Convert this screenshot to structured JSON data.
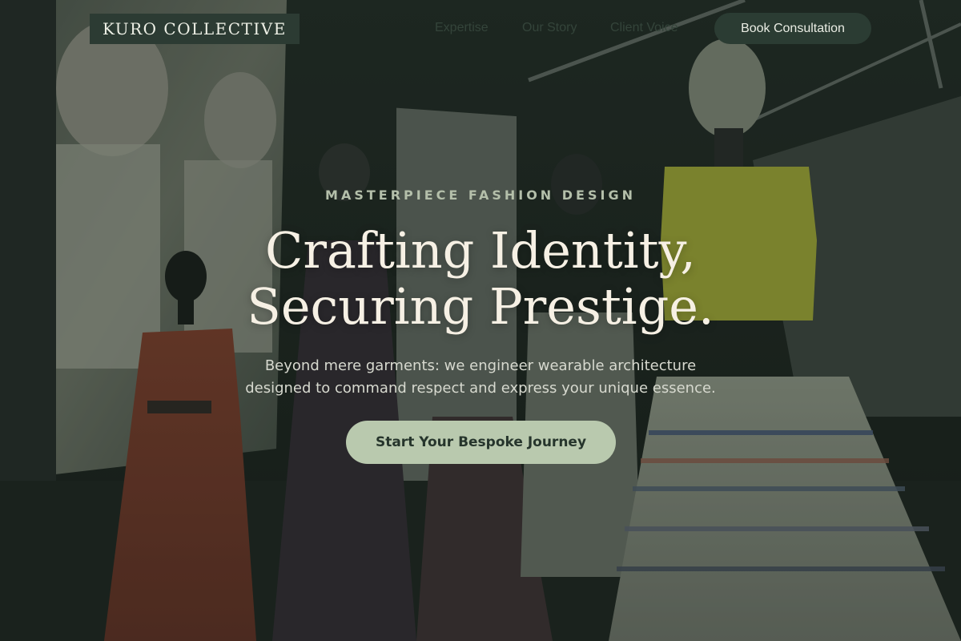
{
  "brand": {
    "name": "KURO COLLECTIVE"
  },
  "nav": {
    "links": [
      "Expertise",
      "Our Story",
      "Client Voice"
    ],
    "cta_label": "Book Consultation"
  },
  "hero": {
    "eyebrow": "MASTERPIECE FASHION DESIGN",
    "headline_lines": [
      "Crafting Identity,",
      "Securing Prestige."
    ],
    "subtext_lines": [
      "Beyond mere garments: we engineer wearable architecture",
      "designed to command respect and express your unique essence."
    ],
    "cta_label": "Start Your Bespoke Journey"
  },
  "colors": {
    "accent": "#b9c9ae",
    "nav_dark": "#2b3c33",
    "headline": "#f6f0e4"
  },
  "icons": [
    "background-photo"
  ]
}
